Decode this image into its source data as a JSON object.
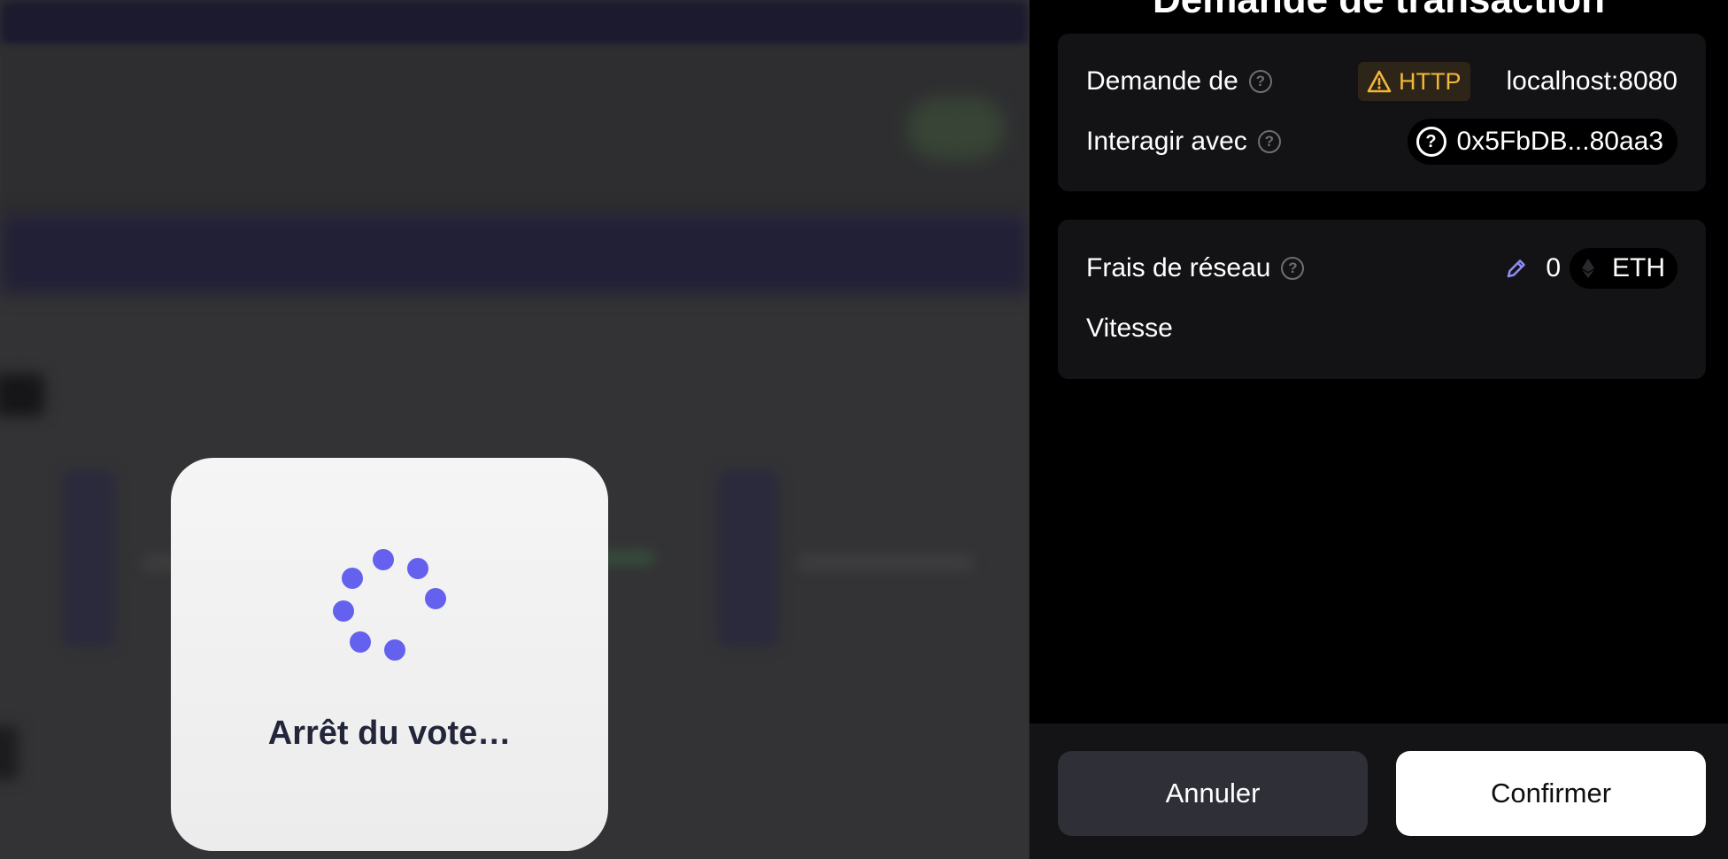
{
  "loading": {
    "text": "Arrêt du vote…"
  },
  "panel": {
    "title": "Demande de transaction",
    "request": {
      "from_label": "Demande de",
      "protocol_badge": "HTTP",
      "host": "localhost:8080",
      "interact_label": "Interagir avec",
      "contract_address": "0x5FbDB...80aa3"
    },
    "fee": {
      "label": "Frais de réseau",
      "value": "0",
      "currency": "ETH",
      "speed_label": "Vitesse"
    },
    "buttons": {
      "cancel": "Annuler",
      "confirm": "Confirmer"
    }
  },
  "colors": {
    "accent": "#6461ee",
    "warning": "#f2b63b",
    "panel_bg": "#000000",
    "section_bg": "#131316"
  },
  "icons": [
    "warning-icon",
    "help-icon",
    "question-circle-icon",
    "pencil-icon",
    "eth-icon",
    "spinner-icon"
  ]
}
